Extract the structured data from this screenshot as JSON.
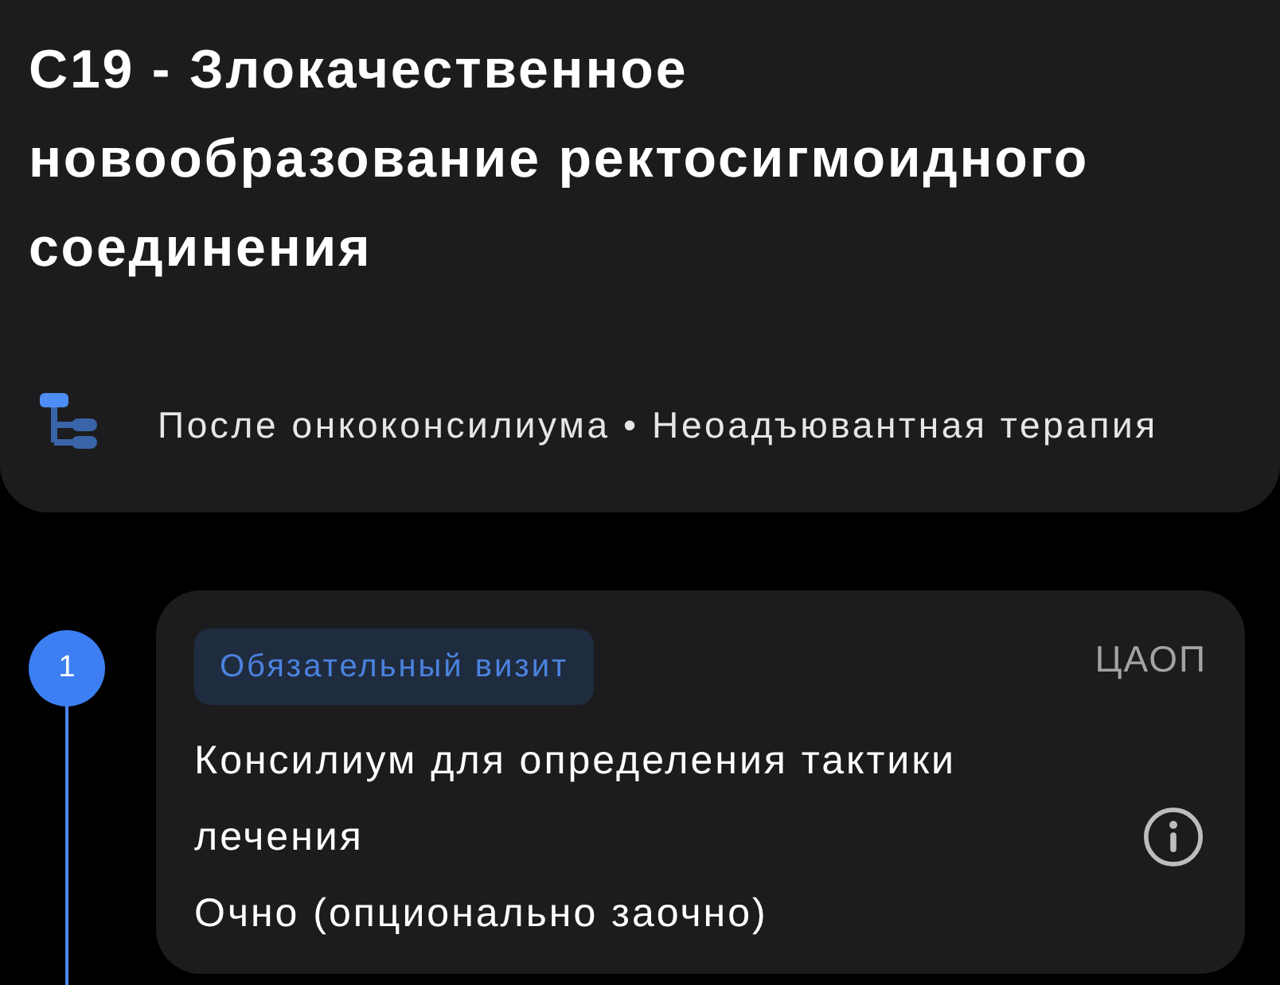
{
  "diagnosis": {
    "title": "C19 - Злокачественное новообразование ректосигмоидного соединения",
    "path": "После онкоконсилиума • Неоадъювантная терапия"
  },
  "steps": [
    {
      "number": "1",
      "badge": "Обязательный визит",
      "organization": "ЦАОП",
      "title": "Консилиум для определения тактики лечения",
      "format": "Очно (опционально заочно)"
    }
  ]
}
